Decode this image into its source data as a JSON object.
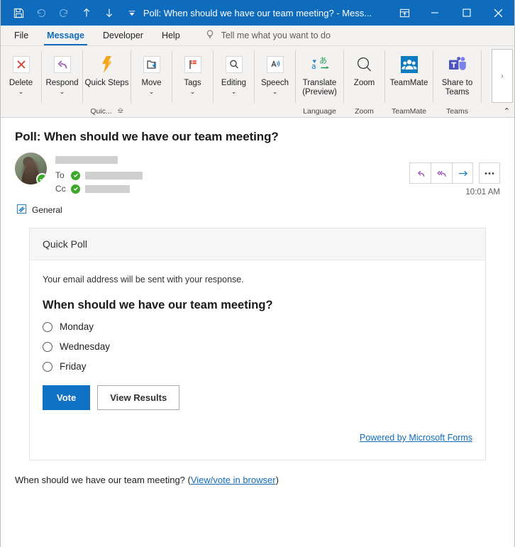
{
  "window": {
    "title": "Poll: When should we have our team meeting?  -  Mess...",
    "quick_access": [
      {
        "name": "save-icon",
        "label": "Save",
        "disabled": false
      },
      {
        "name": "undo-icon",
        "label": "Undo",
        "disabled": true
      },
      {
        "name": "redo-icon",
        "label": "Redo",
        "disabled": true
      },
      {
        "name": "previous-item-icon",
        "label": "Previous Item",
        "disabled": false
      },
      {
        "name": "next-item-icon",
        "label": "Next Item",
        "disabled": false
      },
      {
        "name": "customize-quick-access-toolbar-icon",
        "label": "Customize Quick Access Toolbar",
        "disabled": false
      }
    ],
    "controls": [
      {
        "name": "ribbon-display-options-button",
        "label": "Ribbon Display Options"
      },
      {
        "name": "minimize-button",
        "label": "Minimize"
      },
      {
        "name": "maximize-button",
        "label": "Maximize"
      },
      {
        "name": "close-button",
        "label": "Close"
      }
    ]
  },
  "ribbon": {
    "tabs": [
      {
        "label": "File",
        "active": false
      },
      {
        "label": "Message",
        "active": true
      },
      {
        "label": "Developer",
        "active": false
      },
      {
        "label": "Help",
        "active": false
      }
    ],
    "tellme": "Tell me what you want to do",
    "groups": [
      {
        "label": "",
        "buttons": [
          {
            "label": "Delete",
            "icon": "delete-icon",
            "caret": true
          }
        ]
      },
      {
        "label": "",
        "buttons": [
          {
            "label": "Respond",
            "icon": "respond-icon",
            "caret": true
          }
        ]
      },
      {
        "label": "Quic...",
        "buttons": [
          {
            "label": "Quick Steps",
            "icon": "quick-steps-icon",
            "caret": true
          }
        ]
      },
      {
        "label": "",
        "buttons": [
          {
            "label": "Move",
            "icon": "move-icon",
            "caret": true
          }
        ]
      },
      {
        "label": "",
        "buttons": [
          {
            "label": "Tags",
            "icon": "tags-icon",
            "caret": true
          }
        ]
      },
      {
        "label": "",
        "buttons": [
          {
            "label": "Editing",
            "icon": "editing-icon",
            "caret": true
          }
        ]
      },
      {
        "label": "",
        "buttons": [
          {
            "label": "Speech",
            "icon": "speech-icon",
            "caret": true
          }
        ]
      },
      {
        "label": "Language",
        "buttons": [
          {
            "label": "Translate (Preview)",
            "icon": "translate-icon",
            "caret": true
          }
        ]
      },
      {
        "label": "Zoom",
        "buttons": [
          {
            "label": "Zoom",
            "icon": "zoom-icon",
            "caret": false
          }
        ]
      },
      {
        "label": "TeamMate",
        "buttons": [
          {
            "label": "TeamMate",
            "icon": "teammate-icon",
            "caret": false
          }
        ]
      },
      {
        "label": "Teams",
        "buttons": [
          {
            "label": "Share to Teams",
            "icon": "share-to-teams-icon",
            "caret": false
          }
        ]
      }
    ],
    "overflow_label": "›",
    "collapse_label": "⌃"
  },
  "message": {
    "subject": "Poll: When should we have our team meeting?",
    "to_label": "To",
    "cc_label": "Cc",
    "timestamp": "10:01 AM",
    "sensitivity_label": "General",
    "actions": [
      {
        "name": "reply-button",
        "label": "Reply"
      },
      {
        "name": "reply-all-button",
        "label": "Reply All"
      },
      {
        "name": "forward-button",
        "label": "Forward"
      },
      {
        "name": "more-actions-button",
        "label": "More actions"
      }
    ]
  },
  "poll": {
    "card_title": "Quick Poll",
    "privacy_note": "Your email address will be sent with your response.",
    "question": "When should we have our team meeting?",
    "options": [
      {
        "label": "Monday",
        "selected": false
      },
      {
        "label": "Wednesday",
        "selected": false
      },
      {
        "label": "Friday",
        "selected": false
      }
    ],
    "vote_button": "Vote",
    "view_results_button": "View Results",
    "powered_by": "Powered by Microsoft Forms"
  },
  "body": {
    "text_before": "When should we have our team meeting? (",
    "link_text": "View/vote in browser",
    "text_after": ")"
  },
  "colors": {
    "titlebar": "#0f6cbd",
    "accent": "#0f6cbd",
    "vote_button": "#0f72c5",
    "presence_green": "#3ca82b",
    "delete_red": "#d0392b",
    "respond_purple": "#9a4fb5",
    "quicksteps_orange": "#f2a41b"
  }
}
